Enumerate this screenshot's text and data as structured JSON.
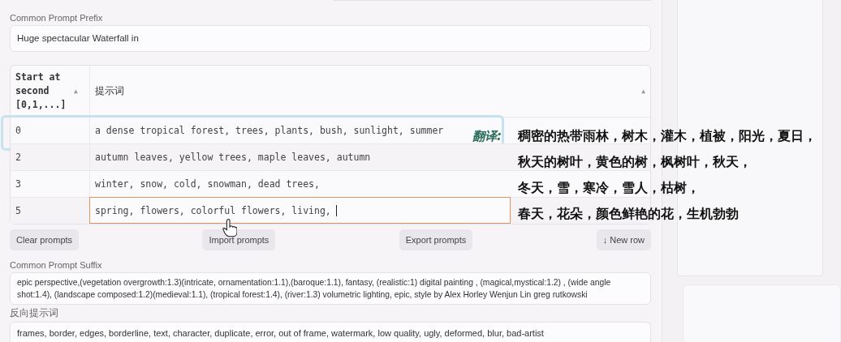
{
  "prefix": {
    "label": "Common Prompt Prefix",
    "value": "Huge spectacular Waterfall in"
  },
  "table": {
    "columns": [
      {
        "label": "Start at second [0,1,...]",
        "sort": "▲"
      },
      {
        "label": "提示词",
        "sort": "▲"
      }
    ],
    "rows": [
      {
        "start": "0",
        "prompt": "a dense tropical forest, trees, plants, bush, sunlight, summer",
        "highlighted": true,
        "editing": false
      },
      {
        "start": "2",
        "prompt": "autumn leaves, yellow trees, maple leaves, autumn",
        "highlighted": false,
        "editing": false
      },
      {
        "start": "3",
        "prompt": "winter, snow, cold, snowman, dead trees,",
        "highlighted": false,
        "editing": false
      },
      {
        "start": "5",
        "prompt": "spring, flowers, colorful flowers, living,",
        "highlighted": false,
        "editing": true
      }
    ]
  },
  "buttons": [
    "Clear prompts",
    "Import prompts",
    "Export prompts",
    "↓ New row"
  ],
  "suffix": {
    "label": "Common Prompt Suffix",
    "value": "epic perspective,(vegetation overgrowth:1.3)(intricate, ornamentation:1.1),(baroque:1.1), fantasy, (realistic:1) digital painting , (magical,mystical:1.2) , (wide angle shot:1.4), (landscape composed:1.2)(medieval:1.1), (tropical forest:1.4), (river:1.3) volumetric lighting, epic, style by Alex Horley Wenjun Lin greg rutkowski"
  },
  "negative": {
    "label": "反向提示词",
    "value": "frames, border, edges, borderline, text, character, duplicate, error, out of frame, watermark, low quality, ugly, deformed, blur, bad-artist"
  },
  "translation": {
    "label": "翻译:",
    "lines": [
      "稠密的热带雨林，树木，灌木，植被，阳光，夏日，",
      "秋天的树叶，黄色的树，枫树叶，秋天，",
      "冬天，雪，寒冷，雪人，枯树，",
      "春天，花朵，颜色鲜艳的花，生机勃勃"
    ]
  }
}
